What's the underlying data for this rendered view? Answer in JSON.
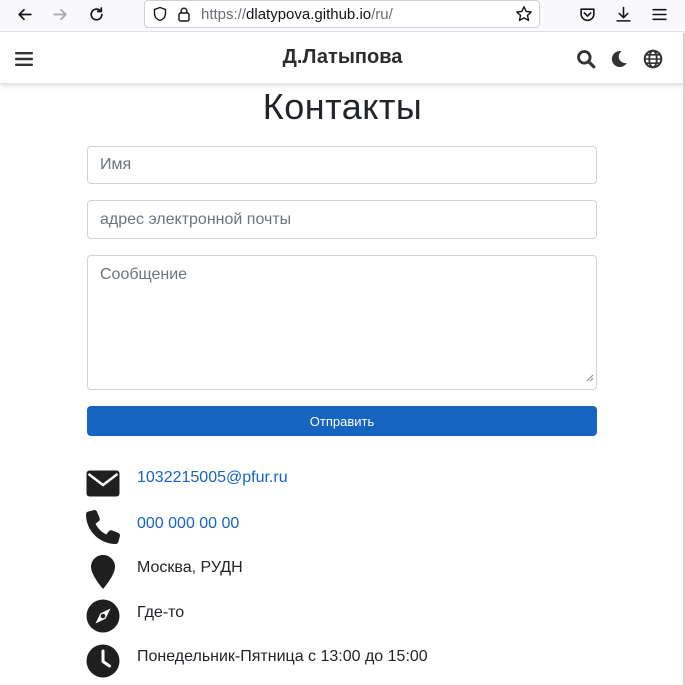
{
  "browser": {
    "url_prefix": "https://",
    "url_domain": "dlatypova.github.io",
    "url_path": "/ru/"
  },
  "navbar": {
    "brand": "Д.Латыпова"
  },
  "page": {
    "title": "Контакты"
  },
  "form": {
    "name_placeholder": "Имя",
    "email_placeholder": "адрес электронной почты",
    "message_placeholder": "Сообщение",
    "submit_label": "Отправить"
  },
  "contacts": {
    "email": "1032215005@pfur.ru",
    "phone": "000 000 00 00",
    "address": "Москва, РУДН",
    "location": "Где-то",
    "hours": "Понедельник-Пятница с 13:00 до 15:00"
  },
  "colors": {
    "accent": "#1565c0",
    "icon": "#1f1f1f"
  }
}
